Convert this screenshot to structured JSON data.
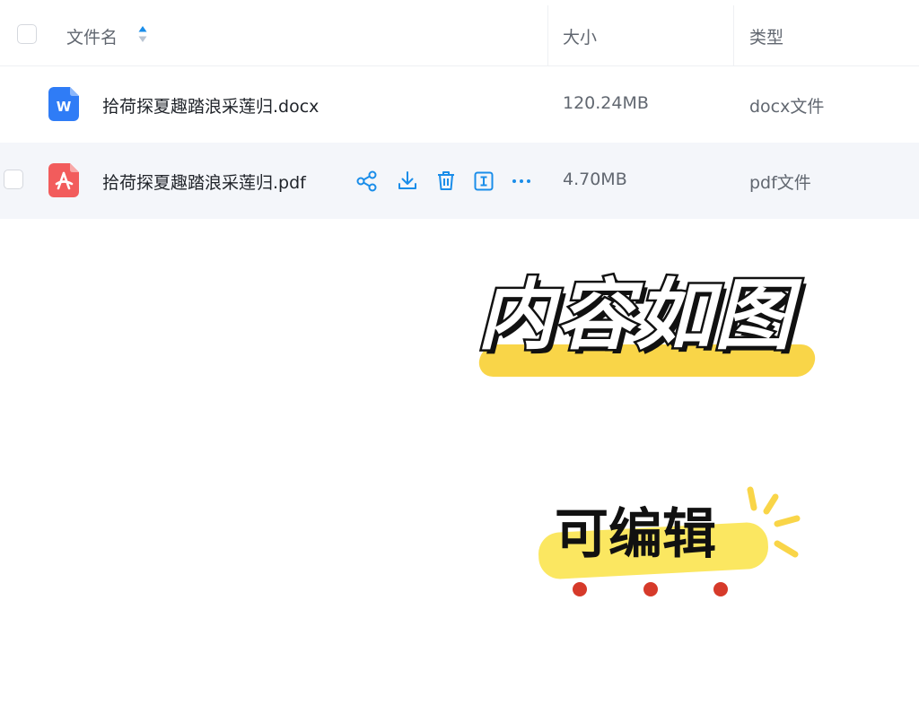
{
  "table": {
    "header": {
      "name_label": "文件名",
      "size_label": "大小",
      "type_label": "类型"
    },
    "rows": [
      {
        "icon": "word-doc-icon",
        "icon_color": "#2f7cf6",
        "name": "拾荷探夏趣踏浪采莲归.docx",
        "size": "120.24MB",
        "type": "docx文件"
      },
      {
        "icon": "pdf-icon",
        "icon_color": "#f25c5c",
        "name": "拾荷探夏趣踏浪采莲归.pdf",
        "size": "4.70MB",
        "type": "pdf文件",
        "actions": [
          "share-icon",
          "download-icon",
          "delete-icon",
          "rename-icon",
          "more-icon"
        ]
      }
    ]
  },
  "overlay": {
    "headline": "内容如图",
    "subline": "可编辑"
  },
  "colors": {
    "accent": "#1a8de9",
    "highlight_yellow": "#f9d548",
    "dot_red": "#d63a2a"
  }
}
